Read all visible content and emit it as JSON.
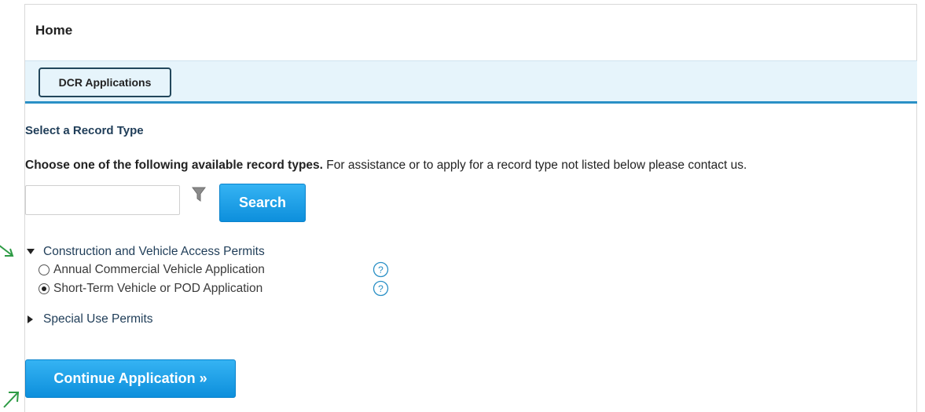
{
  "header": {
    "title": "Home"
  },
  "tabs": {
    "active_label": "DCR Applications"
  },
  "section": {
    "title": "Select a Record Type",
    "instruction_bold": "Choose one of the following available record types.",
    "instruction_rest": " For assistance or to apply for a record type not listed below please contact us."
  },
  "search": {
    "value": "",
    "placeholder": "",
    "button_label": "Search"
  },
  "record_groups": [
    {
      "label": "Construction and Vehicle Access Permits",
      "expanded": true,
      "items": [
        {
          "label": "Annual Commercial Vehicle Application",
          "selected": false
        },
        {
          "label": "Short-Term Vehicle or POD Application",
          "selected": true
        }
      ]
    },
    {
      "label": "Special Use Permits",
      "expanded": false
    }
  ],
  "actions": {
    "continue_label": "Continue Application »"
  },
  "icons": {
    "filter": "filter-icon",
    "help": "help-icon",
    "annotation_arrow": "green-arrow-icon"
  },
  "colors": {
    "accent": "#1596e3",
    "tab_bg": "#e6f4fb",
    "tab_border": "#2a90c6",
    "annotation": "#2e9b45"
  }
}
